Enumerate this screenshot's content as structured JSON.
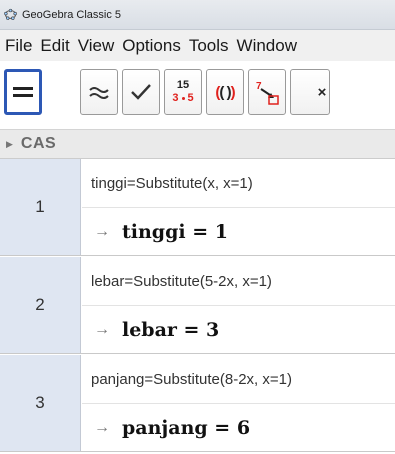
{
  "window": {
    "title": "GeoGebra Classic 5"
  },
  "menu": [
    {
      "label": "File"
    },
    {
      "label": "Edit"
    },
    {
      "label": "View"
    },
    {
      "label": "Options"
    },
    {
      "label": "Tools"
    },
    {
      "label": "Window"
    }
  ],
  "toolbar": {
    "tools": [
      {
        "name": "evaluate-tool",
        "icon": "equals-icon",
        "selected": true
      },
      {
        "name": "numeric-tool",
        "icon": "approx-icon",
        "selected": false
      },
      {
        "name": "keep-input-tool",
        "icon": "check-icon",
        "selected": false
      },
      {
        "name": "factor-tool",
        "icon": "factor-icon",
        "top": "15",
        "bottom_a": "3",
        "bottom_b": "5",
        "selected": false
      },
      {
        "name": "expand-tool",
        "icon": "parentheses-icon",
        "text": "(( ))",
        "selected": false
      },
      {
        "name": "substitute-tool",
        "icon": "substitute-icon",
        "digit": "7",
        "selected": false
      }
    ],
    "accent": "#2d58b5",
    "red": "#e0211d"
  },
  "section": {
    "title": "CAS"
  },
  "cas": {
    "rows": [
      {
        "number": "1",
        "input": "tinggi=Substitute(x, x=1)",
        "arrow": "→",
        "output": "tinggi = 1"
      },
      {
        "number": "2",
        "input": "lebar=Substitute(5-2x, x=1)",
        "arrow": "→",
        "output": "lebar = 3"
      },
      {
        "number": "3",
        "input": "panjang=Substitute(8-2x, x=1)",
        "arrow": "→",
        "output": "panjang = 6"
      }
    ]
  }
}
